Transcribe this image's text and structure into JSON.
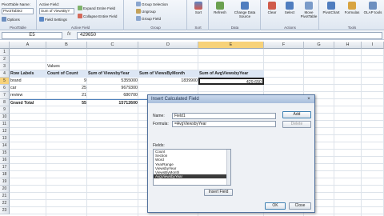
{
  "ribbon": {
    "pivottable_name_label": "PivotTable Name:",
    "pivottable_name_value": "PivotTable2",
    "options_label": "Options",
    "active_field_label": "Active Field:",
    "active_field_value": "Sum of ViewsByY",
    "field_settings_label": "Field Settings",
    "expand_label": "Expand Entire Field",
    "collapse_label": "Collapse Entire Field",
    "group_selection_label": "Group Selection",
    "ungroup_label": "Ungroup",
    "group_field_label": "Group Field",
    "sort_label": "Sort",
    "refresh_label": "Refresh",
    "change_source_label": "Change Data Source",
    "clear_label": "Clear",
    "select_label": "Select",
    "move_label": "Move PivotTable",
    "pivotchart_label": "PivotChart",
    "formulas_label": "Formulas",
    "olap_label": "OLAP tools",
    "groups": {
      "pivottable": "PivotTable",
      "active_field": "Active Field",
      "group": "Group",
      "sort": "Sort",
      "data": "Data",
      "actions": "Actions",
      "tools": "Tools"
    }
  },
  "formula_bar": {
    "name_box": "E5",
    "fx": "fx",
    "value": "429650"
  },
  "grid": {
    "columns": [
      "A",
      "B",
      "C",
      "D",
      "E",
      "F",
      "G",
      "H",
      "I"
    ],
    "rows": [
      "1",
      "2",
      "3",
      "4",
      "5",
      "6",
      "7",
      "8",
      "9",
      "10",
      "11",
      "12",
      "13",
      "14",
      "15",
      "16",
      "17",
      "18",
      "19",
      "20",
      "21",
      "22",
      "23"
    ],
    "values_label": "Values",
    "headers": [
      "Row Labels",
      "Count of Count",
      "Sum of ViewsbyYear",
      "Sum of ViewsByMonth",
      "Sum of AvgViewsbyYear"
    ],
    "data_rows": [
      [
        "brand",
        "9",
        "5355000",
        "1839900",
        "429,650"
      ],
      [
        "car",
        "25",
        "9679300",
        "",
        ""
      ],
      [
        "review",
        "21",
        "680700",
        "",
        ""
      ]
    ],
    "total_row": [
      "Grand Total",
      "55",
      "15712600",
      "",
      ""
    ]
  },
  "dialog": {
    "title": "Insert Calculated Field",
    "close_symbol": "×",
    "name_label": "Name:",
    "name_value": "Field1",
    "formula_label": "Formula:",
    "formula_value": "=AvgViewsbyYear",
    "add_label": "Add",
    "delete_label": "Delete",
    "fields_label": "Fields:",
    "fields": [
      "Count",
      "Section",
      "Word",
      "YearRange",
      "ViewsbyYear",
      "ViewsByMonth",
      "AvgViewsbyYear"
    ],
    "insert_field_label": "Insert Field",
    "ok_label": "OK",
    "close_label": "Close"
  }
}
